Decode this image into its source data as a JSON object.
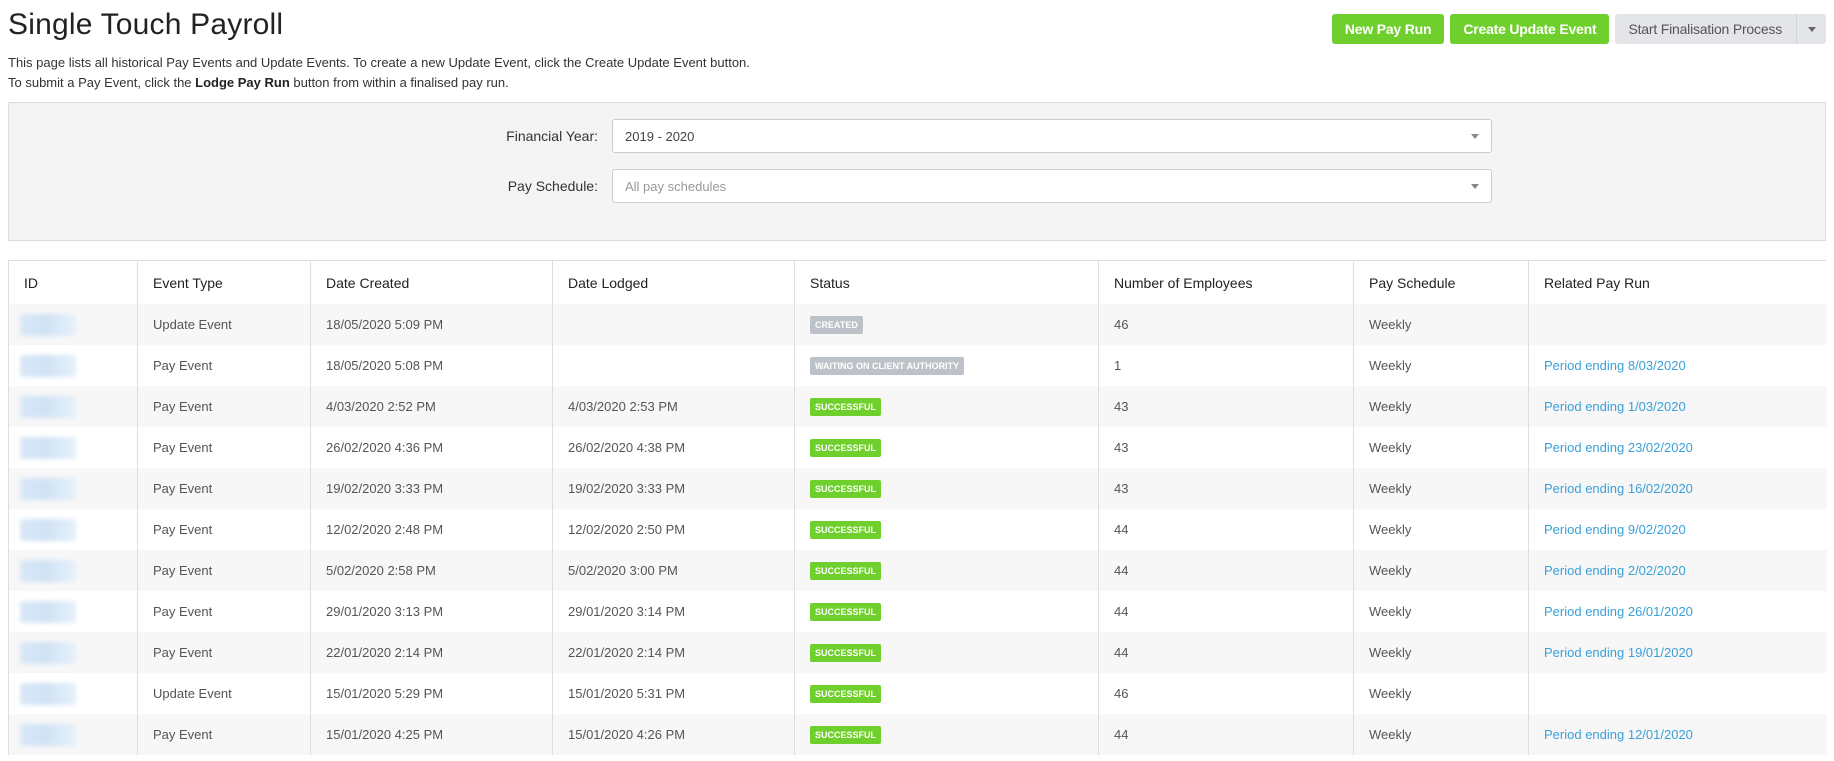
{
  "header": {
    "title": "Single Touch Payroll",
    "desc_line1": "This page lists all historical Pay Events and Update Events. To create a new Update Event, click the Create Update Event button.",
    "desc_line2_pre": "To submit a Pay Event, click the ",
    "desc_line2_bold": "Lodge Pay Run",
    "desc_line2_post": " button from within a finalised pay run."
  },
  "actions": {
    "new_pay_run": "New Pay Run",
    "create_update_event": "Create Update Event",
    "start_finalisation": "Start Finalisation Process"
  },
  "filters": {
    "financial_year_label": "Financial Year:",
    "financial_year_value": "2019 - 2020",
    "pay_schedule_label": "Pay Schedule:",
    "pay_schedule_placeholder": "All pay schedules"
  },
  "colors": {
    "primary_green": "#6fcf2c",
    "grey_badge": "#bcc2c8",
    "link_blue": "#3aa0d8"
  },
  "table": {
    "columns": [
      "ID",
      "Event Type",
      "Date Created",
      "Date Lodged",
      "Status",
      "Number of Employees",
      "Pay Schedule",
      "Related Pay Run"
    ],
    "rows": [
      {
        "event_type": "Update Event",
        "date_created": "18/05/2020 5:09 PM",
        "date_lodged": "",
        "status": "CREATED",
        "status_color": "grey",
        "employees": "46",
        "pay_schedule": "Weekly",
        "related": ""
      },
      {
        "event_type": "Pay Event",
        "date_created": "18/05/2020 5:08 PM",
        "date_lodged": "",
        "status": "WAITING ON CLIENT AUTHORITY",
        "status_color": "grey",
        "employees": "1",
        "pay_schedule": "Weekly",
        "related": "Period ending 8/03/2020"
      },
      {
        "event_type": "Pay Event",
        "date_created": "4/03/2020 2:52 PM",
        "date_lodged": "4/03/2020 2:53 PM",
        "status": "SUCCESSFUL",
        "status_color": "green",
        "employees": "43",
        "pay_schedule": "Weekly",
        "related": "Period ending 1/03/2020"
      },
      {
        "event_type": "Pay Event",
        "date_created": "26/02/2020 4:36 PM",
        "date_lodged": "26/02/2020 4:38 PM",
        "status": "SUCCESSFUL",
        "status_color": "green",
        "employees": "43",
        "pay_schedule": "Weekly",
        "related": "Period ending 23/02/2020"
      },
      {
        "event_type": "Pay Event",
        "date_created": "19/02/2020 3:33 PM",
        "date_lodged": "19/02/2020 3:33 PM",
        "status": "SUCCESSFUL",
        "status_color": "green",
        "employees": "43",
        "pay_schedule": "Weekly",
        "related": "Period ending 16/02/2020"
      },
      {
        "event_type": "Pay Event",
        "date_created": "12/02/2020 2:48 PM",
        "date_lodged": "12/02/2020 2:50 PM",
        "status": "SUCCESSFUL",
        "status_color": "green",
        "employees": "44",
        "pay_schedule": "Weekly",
        "related": "Period ending 9/02/2020"
      },
      {
        "event_type": "Pay Event",
        "date_created": "5/02/2020 2:58 PM",
        "date_lodged": "5/02/2020 3:00 PM",
        "status": "SUCCESSFUL",
        "status_color": "green",
        "employees": "44",
        "pay_schedule": "Weekly",
        "related": "Period ending 2/02/2020"
      },
      {
        "event_type": "Pay Event",
        "date_created": "29/01/2020 3:13 PM",
        "date_lodged": "29/01/2020 3:14 PM",
        "status": "SUCCESSFUL",
        "status_color": "green",
        "employees": "44",
        "pay_schedule": "Weekly",
        "related": "Period ending 26/01/2020"
      },
      {
        "event_type": "Pay Event",
        "date_created": "22/01/2020 2:14 PM",
        "date_lodged": "22/01/2020 2:14 PM",
        "status": "SUCCESSFUL",
        "status_color": "green",
        "employees": "44",
        "pay_schedule": "Weekly",
        "related": "Period ending 19/01/2020"
      },
      {
        "event_type": "Update Event",
        "date_created": "15/01/2020 5:29 PM",
        "date_lodged": "15/01/2020 5:31 PM",
        "status": "SUCCESSFUL",
        "status_color": "green",
        "employees": "46",
        "pay_schedule": "Weekly",
        "related": ""
      },
      {
        "event_type": "Pay Event",
        "date_created": "15/01/2020 4:25 PM",
        "date_lodged": "15/01/2020 4:26 PM",
        "status": "SUCCESSFUL",
        "status_color": "green",
        "employees": "44",
        "pay_schedule": "Weekly",
        "related": "Period ending 12/01/2020"
      }
    ]
  }
}
